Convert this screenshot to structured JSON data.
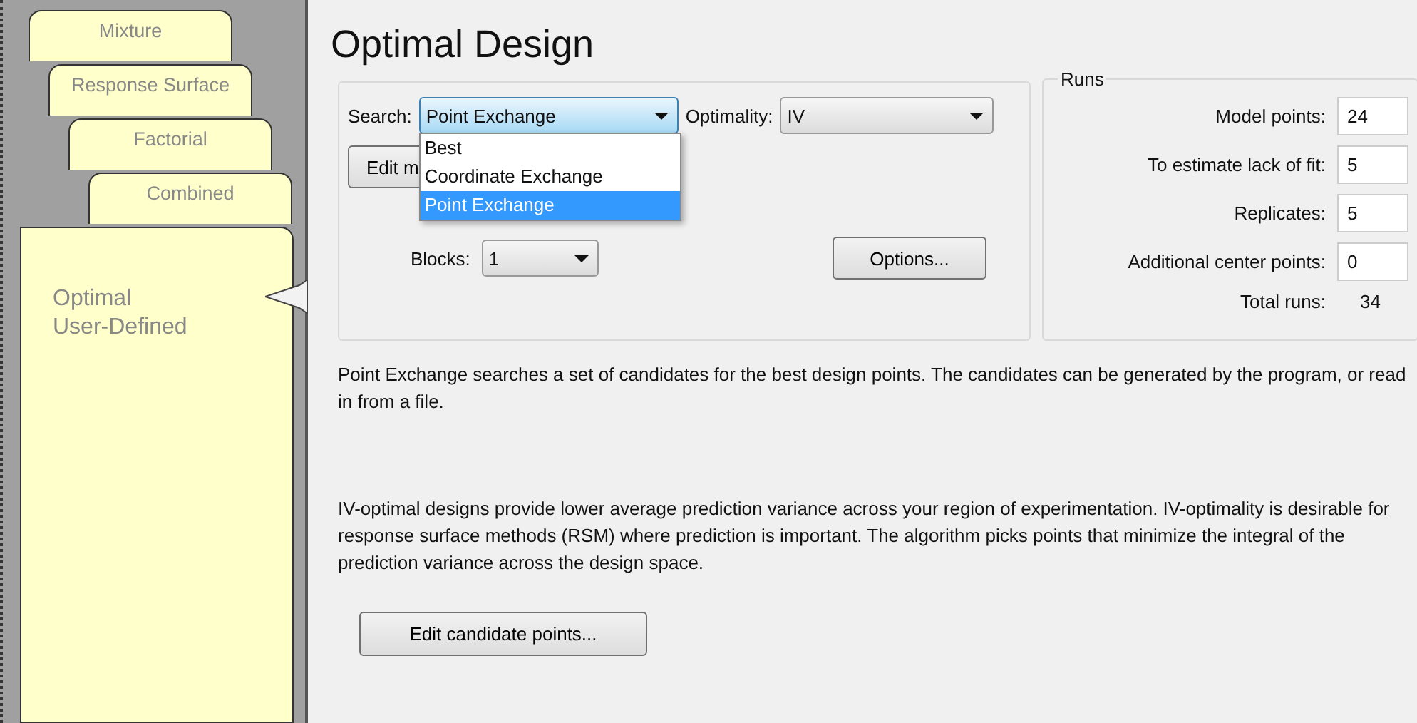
{
  "sidebar": {
    "tabs": [
      {
        "label": "Mixture",
        "selected": false
      },
      {
        "label": "Response Surface",
        "selected": false
      },
      {
        "label": "Factorial",
        "selected": false
      },
      {
        "label": "Combined",
        "selected": false
      },
      {
        "label": "Optimal\nUser-Defined",
        "selected": true
      }
    ]
  },
  "title": "Optimal Design",
  "search": {
    "label": "Search:",
    "value": "Point Exchange",
    "expanded": true,
    "options": [
      {
        "label": "Best",
        "selected": false
      },
      {
        "label": "Coordinate Exchange",
        "selected": false
      },
      {
        "label": "Point Exchange",
        "selected": true
      }
    ]
  },
  "optimality": {
    "label": "Optimality:",
    "value": "IV"
  },
  "edit_model_button": "Edit m",
  "blocks": {
    "label": "Blocks:",
    "value": "1"
  },
  "options_button": "Options...",
  "runs": {
    "title": "Runs",
    "fields": [
      {
        "label": "Model points:",
        "value": "24"
      },
      {
        "label": "To estimate lack of fit:",
        "value": "5"
      },
      {
        "label": "Replicates:",
        "value": "5"
      },
      {
        "label": "Additional center points:",
        "value": "0"
      }
    ],
    "total_label": "Total runs:",
    "total_value": "34"
  },
  "search_description": "Point Exchange searches a set of candidates for the best design points. The candidates can be generated by the program, or read in from a file.",
  "optimality_description": "IV-optimal designs provide lower average prediction variance across your region of experimentation.  IV-optimality is desirable for response surface methods (RSM) where prediction is important.  The algorithm picks points that minimize the integral of the prediction variance across the design space.",
  "edit_candidates_button": "Edit candidate points..."
}
